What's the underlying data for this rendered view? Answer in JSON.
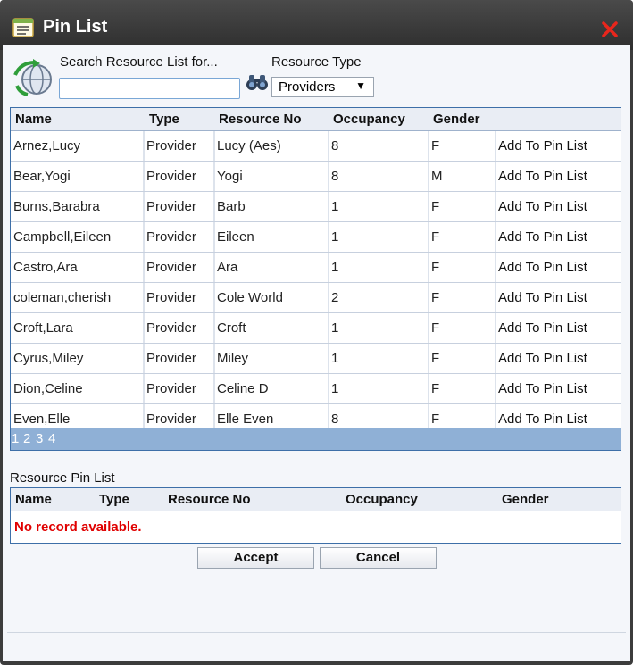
{
  "window": {
    "title": "Pin List",
    "app_icon": "list-window-icon",
    "close_icon": "close-x-icon",
    "close_color": "#e8261c"
  },
  "search": {
    "label": "Search Resource List for...",
    "value": "",
    "placeholder": "",
    "search_icon": "binoculars-icon",
    "globe_icon": "globe-refresh-icon"
  },
  "resource_type": {
    "label": "Resource Type",
    "selected": "Providers",
    "arrow": "▼"
  },
  "resource_grid": {
    "columns": [
      "Name",
      "Type",
      "Resource No",
      "Occupancy",
      "Gender"
    ],
    "rows": [
      {
        "name": "Arnez,Lucy",
        "type": "Provider",
        "resource_no": "Lucy (Aes)",
        "occupancy": "8",
        "gender": "F",
        "action": "Add To Pin List"
      },
      {
        "name": "Bear,Yogi",
        "type": "Provider",
        "resource_no": "Yogi",
        "occupancy": "8",
        "gender": "M",
        "action": "Add To Pin List"
      },
      {
        "name": "Burns,Barabra",
        "type": "Provider",
        "resource_no": "Barb",
        "occupancy": "1",
        "gender": "F",
        "action": "Add To Pin List"
      },
      {
        "name": "Campbell,Eileen",
        "type": "Provider",
        "resource_no": "Eileen",
        "occupancy": "1",
        "gender": "F",
        "action": "Add To Pin List"
      },
      {
        "name": "Castro,Ara",
        "type": "Provider",
        "resource_no": "Ara",
        "occupancy": "1",
        "gender": "F",
        "action": "Add To Pin List"
      },
      {
        "name": "coleman,cherish",
        "type": "Provider",
        "resource_no": "Cole World",
        "occupancy": "2",
        "gender": "F",
        "action": "Add To Pin List"
      },
      {
        "name": "Croft,Lara",
        "type": "Provider",
        "resource_no": "Croft",
        "occupancy": "1",
        "gender": "F",
        "action": "Add To Pin List"
      },
      {
        "name": "Cyrus,Miley",
        "type": "Provider",
        "resource_no": "Miley",
        "occupancy": "1",
        "gender": "F",
        "action": "Add To Pin List"
      },
      {
        "name": "Dion,Celine",
        "type": "Provider",
        "resource_no": "Celine D",
        "occupancy": "1",
        "gender": "F",
        "action": "Add To Pin List"
      },
      {
        "name": "Even,Elle",
        "type": "Provider",
        "resource_no": "Elle Even",
        "occupancy": "8",
        "gender": "F",
        "action": "Add To Pin List"
      }
    ],
    "pages": [
      "1",
      "2",
      "3",
      "4"
    ],
    "pager_color": "#8fb0d6"
  },
  "pin_grid": {
    "title": "Resource Pin List",
    "columns": [
      "Name",
      "Type",
      "Resource No",
      "Occupancy",
      "Gender"
    ],
    "empty_message": "No record available.",
    "empty_color": "#e00000"
  },
  "buttons": {
    "accept": "Accept",
    "cancel": "Cancel"
  }
}
